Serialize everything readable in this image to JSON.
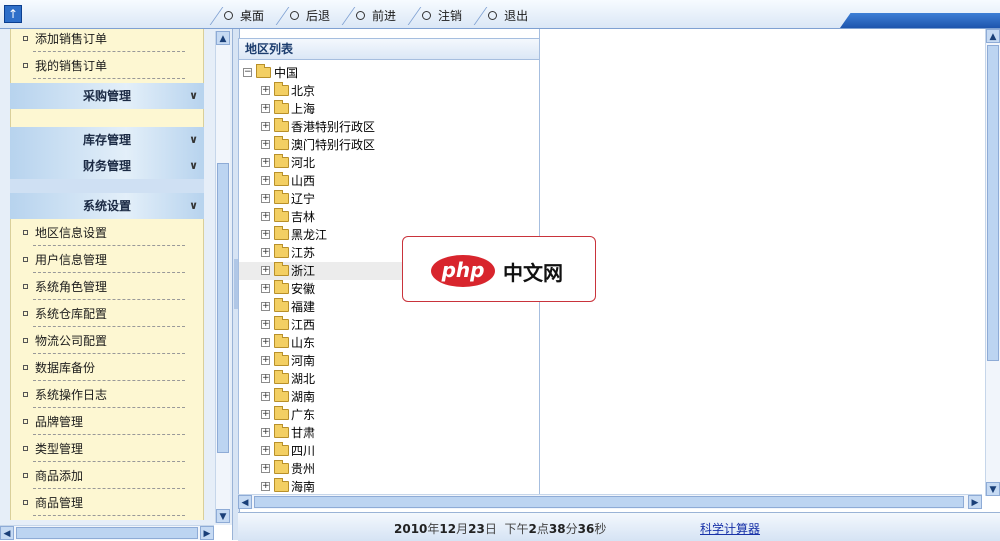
{
  "topbar": {
    "nav": [
      {
        "name": "desktop",
        "label": "桌面"
      },
      {
        "name": "back",
        "label": "后退"
      },
      {
        "name": "forward",
        "label": "前进"
      },
      {
        "name": "logout",
        "label": "注销"
      },
      {
        "name": "exit",
        "label": "退出"
      }
    ]
  },
  "sidebar": {
    "sales_items": [
      "添加销售订单",
      "我的销售订单"
    ],
    "purchase_header": "采购管理",
    "inventory_header": "库存管理",
    "finance_header": "财务管理",
    "system_header": "系统设置",
    "system_items": [
      "地区信息设置",
      "用户信息管理",
      "系统角色管理",
      "系统仓库配置",
      "物流公司配置",
      "数据库备份",
      "系统操作日志",
      "品牌管理",
      "类型管理",
      "商品添加",
      "商品管理"
    ]
  },
  "tree": {
    "title": "地区列表",
    "root": "中国",
    "children": [
      "北京",
      "上海",
      "香港特别行政区",
      "澳门特别行政区",
      "河北",
      "山西",
      "辽宁",
      "吉林",
      "黑龙江",
      "江苏",
      "浙江",
      "安徽",
      "福建",
      "江西",
      "山东",
      "河南",
      "湖北",
      "湖南",
      "广东",
      "甘肃",
      "四川",
      "贵州",
      "海南"
    ]
  },
  "watermark": {
    "logo": "php",
    "text": "中文网"
  },
  "status": {
    "year": "2010",
    "year_unit": "年",
    "month": "12",
    "month_unit": "月",
    "day": "23",
    "day_unit": "日",
    "period": "下午",
    "hour": "2",
    "hour_unit": "点",
    "minute": "38",
    "minute_unit": "分",
    "second": "36",
    "second_unit": "秒",
    "calc_link": "科学计算器"
  },
  "icons": {
    "app": "up-arrow-icon",
    "collapse": "chevron-down-icon"
  }
}
